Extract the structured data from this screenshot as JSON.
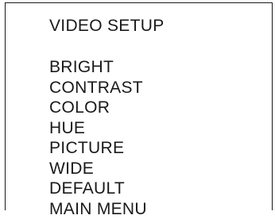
{
  "menu": {
    "title": "VIDEO SETUP",
    "items": [
      {
        "label": "BRIGHT"
      },
      {
        "label": "CONTRAST"
      },
      {
        "label": "COLOR"
      },
      {
        "label": "HUE"
      },
      {
        "label": "PICTURE"
      },
      {
        "label": "WIDE"
      },
      {
        "label": "DEFAULT"
      },
      {
        "label": "MAIN MENU"
      }
    ]
  },
  "colors": {
    "background": "#ffffff",
    "text": "#1a1a1a",
    "border": "#1a1a1a"
  }
}
